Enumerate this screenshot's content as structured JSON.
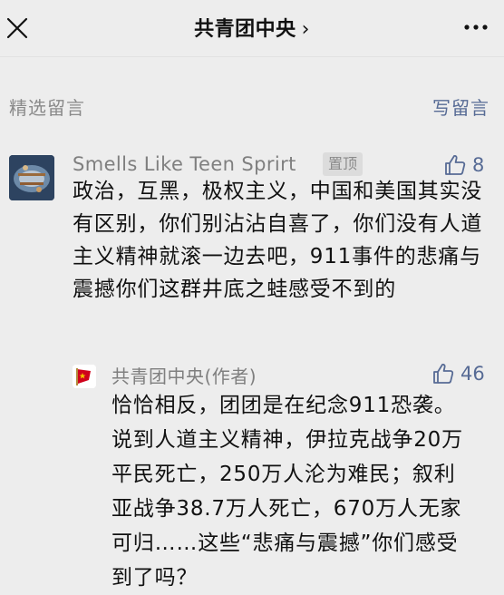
{
  "header": {
    "title": "共青团中央",
    "chevron": "›"
  },
  "section": {
    "title": "精选留言",
    "write_label": "写留言"
  },
  "comment": {
    "username": "Smells Like Teen Sprirt",
    "pin_label": "置顶",
    "likes": "8",
    "text": "政治，互黑，极权主义，中国和美国其实没有区别，你们别沾沾自喜了，你们没有人道主义精神就滚一边去吧，911事件的悲痛与震撼你们这群井底之蛙感受不到的"
  },
  "reply": {
    "name": "共青团中央(作者)",
    "likes": "46",
    "text": "恰恰相反，团团是在纪念911恐袭。说到人道主义精神，伊拉克战争20万平民死亡，250万人沦为难民；叙利亚战争38.7万人死亡，670万人无家可归……这些“悲痛与震撼”你们感受到了吗？"
  },
  "colors": {
    "accent_blue": "#576b95",
    "muted_gray": "#8a8a8a",
    "background": "#ededed"
  }
}
